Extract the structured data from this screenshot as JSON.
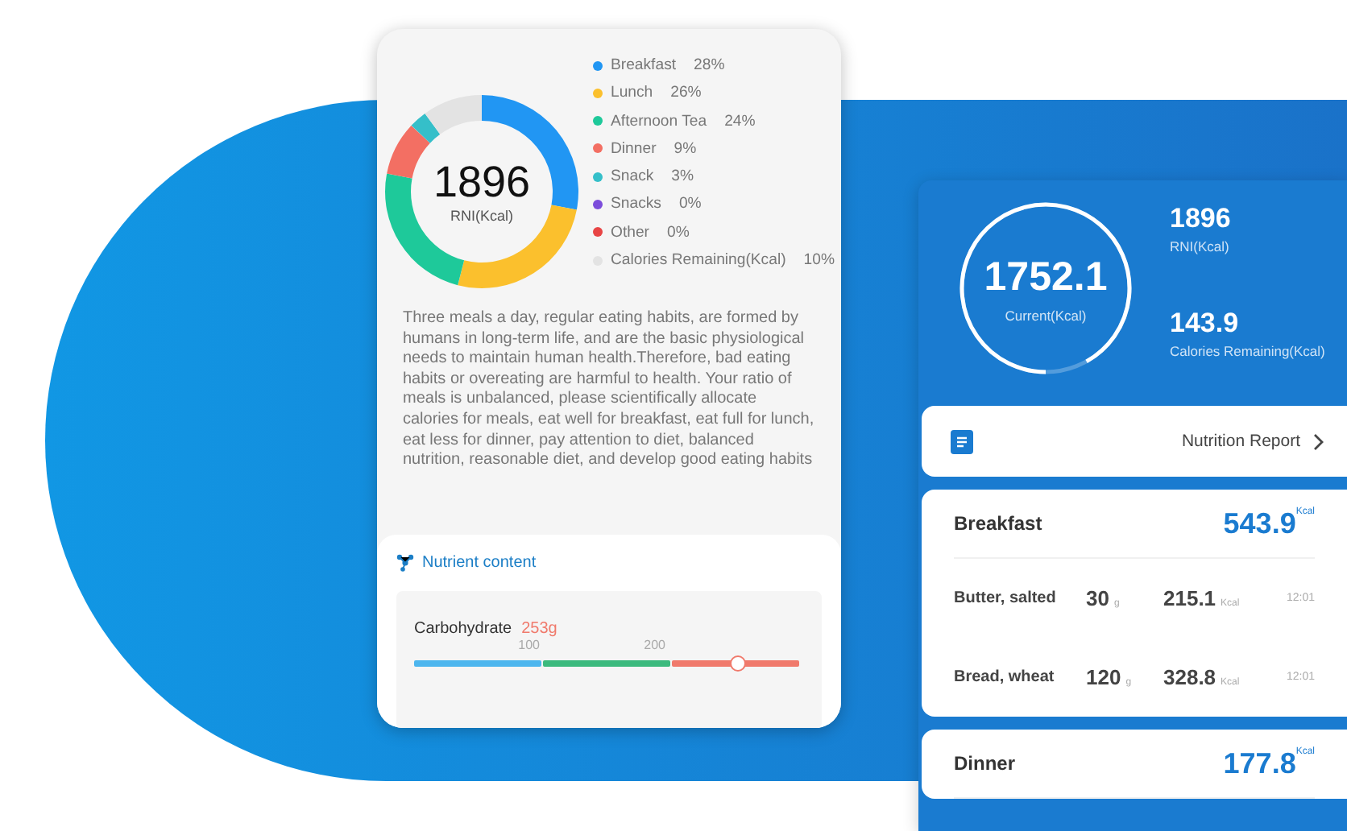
{
  "ratio_card": {
    "total": "1896",
    "total_label": "RNI(Kcal)",
    "chart_data": {
      "type": "donut",
      "categories": [
        "Breakfast",
        "Lunch",
        "Afternoon Tea",
        "Dinner",
        "Snack",
        "Snacks",
        "Other",
        "Calories Remaining(Kcal)"
      ],
      "colors": [
        "#2196f3",
        "#fbc02d",
        "#1ec99a",
        "#f36f63",
        "#35bfc9",
        "#7c4ddb",
        "#e84545",
        "#e3e3e3"
      ],
      "series": [
        {
          "values": [
            28,
            26,
            24,
            9,
            3,
            0,
            0,
            10
          ]
        }
      ],
      "value_labels": [
        "28%",
        "26%",
        "24%",
        "9%",
        "3%",
        "0%",
        "0%",
        "10%"
      ]
    },
    "advice": "Three meals a day, regular eating habits, are formed by humans in long-term life, and are the basic physiological needs to maintain human health.Therefore, bad eating habits or overeating are harmful to health. Your ratio of meals is unbalanced, please scientifically allocate calories for meals, eat well for breakfast, eat full for lunch, eat less for dinner, pay attention to diet, balanced nutrition, reasonable diet, and develop good eating habits",
    "nutrient_title": "Nutrient content",
    "nutrient": {
      "name": "Carbohydrate",
      "amount": "253g",
      "ticks": [
        "100",
        "200"
      ],
      "level": 0.84
    }
  },
  "intake_card": {
    "current": "1752.1",
    "current_label": "Current(Kcal)",
    "level": 0.92,
    "stats": [
      {
        "value": "1896",
        "label": "RNI(Kcal)"
      },
      {
        "value": "143.9",
        "label": "Calories Remaining(Kcal)"
      }
    ],
    "report": "Nutrition Report",
    "meals": [
      {
        "name": "Breakfast",
        "total": "543.9",
        "unit": "Kcal",
        "foods": [
          {
            "name": "Butter, salted",
            "amount": "30",
            "amount_unit": "g",
            "kcal": "215.1",
            "kcal_unit": "Kcal",
            "time": "12:01"
          },
          {
            "name": "Bread, wheat",
            "amount": "120",
            "amount_unit": "g",
            "kcal": "328.8",
            "kcal_unit": "Kcal",
            "time": "12:01"
          }
        ]
      },
      {
        "name": "Dinner",
        "total": "177.8",
        "unit": "Kcal"
      }
    ]
  }
}
